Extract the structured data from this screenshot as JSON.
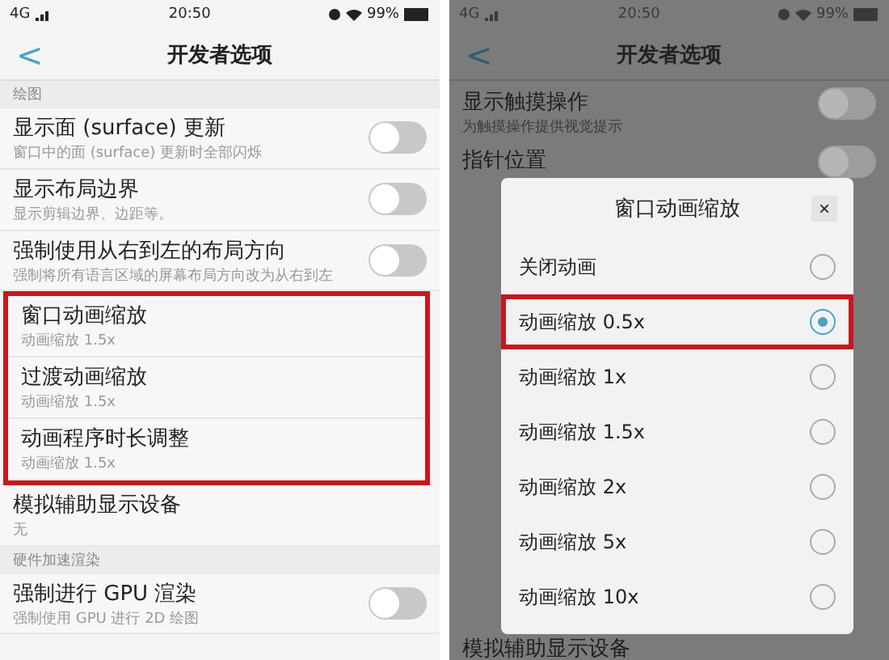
{
  "left_screen": {
    "status_bar": {
      "network": "4G",
      "time": "20:50",
      "battery": "99%"
    },
    "header": {
      "back": "<",
      "title": "开发者选项"
    },
    "rows": [
      {
        "kind": "section",
        "title": "绘图"
      },
      {
        "kind": "toggle",
        "title": "显示面 (surface) 更新",
        "subtitle": "窗口中的面 (surface) 更新时全部闪烁",
        "on": false,
        "highlighted": false
      },
      {
        "kind": "toggle",
        "title": "显示布局边界",
        "subtitle": "显示剪辑边界、边距等。",
        "on": false,
        "highlighted": false
      },
      {
        "kind": "toggle",
        "title": "强制使用从右到左的布局方向",
        "subtitle": "强制将所有语言区域的屏幕布局方向改为从右到左",
        "on": false,
        "highlighted": false
      },
      {
        "kind": "value",
        "title": "窗口动画缩放",
        "subtitle": "动画缩放 1.5x",
        "highlighted": true
      },
      {
        "kind": "value",
        "title": "过渡动画缩放",
        "subtitle": "动画缩放 1.5x",
        "highlighted": true
      },
      {
        "kind": "value",
        "title": "动画程序时长调整",
        "subtitle": "动画缩放 1.5x",
        "highlighted": true
      },
      {
        "kind": "value",
        "title": "模拟辅助显示设备",
        "subtitle": "无",
        "highlighted": false
      },
      {
        "kind": "section",
        "title": "硬件加速渲染"
      },
      {
        "kind": "toggle",
        "title": "强制进行 GPU 渲染",
        "subtitle": "强制使用 GPU 进行 2D 绘图",
        "on": false,
        "highlighted": false
      }
    ]
  },
  "right_screen": {
    "status_bar": {
      "network": "4G",
      "time": "20:50",
      "battery": "99%"
    },
    "header": {
      "back": "<",
      "title": "开发者选项"
    },
    "background_rows": [
      {
        "title": "显示触摸操作",
        "subtitle": "为触摸操作提供视觉提示",
        "on": false
      },
      {
        "title": "指针位置",
        "on": false
      }
    ],
    "bottom_row": {
      "title": "模拟辅助显示设备"
    },
    "dialog": {
      "title": "窗口动画缩放",
      "close": "×",
      "options": [
        {
          "label": "关闭动画",
          "selected": false
        },
        {
          "label": "动画缩放 0.5x",
          "selected": true
        },
        {
          "label": "动画缩放 1x",
          "selected": false
        },
        {
          "label": "动画缩放 1.5x",
          "selected": false
        },
        {
          "label": "动画缩放 2x",
          "selected": false
        },
        {
          "label": "动画缩放 5x",
          "selected": false
        },
        {
          "label": "动画缩放 10x",
          "selected": false
        }
      ]
    }
  }
}
